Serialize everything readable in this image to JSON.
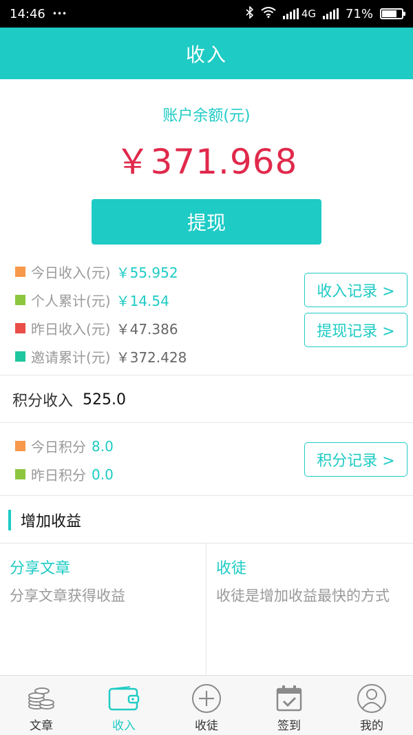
{
  "status_bar": {
    "time": "14:46",
    "dots": "•••",
    "network": "4G",
    "battery": "71%",
    "battery_level": 0.71
  },
  "header": {
    "title": "收入"
  },
  "balance": {
    "label": "账户余额(元)",
    "value": "￥371.968"
  },
  "withdraw_button": "提现",
  "stats": [
    {
      "label": "今日收入(元)",
      "value": "￥55.952",
      "color": "#f7984a",
      "tone": "teal"
    },
    {
      "label": "个人累计(元)",
      "value": "￥14.54",
      "color": "#8cc63f",
      "tone": "teal"
    },
    {
      "label": "昨日收入(元)",
      "value": "￥47.386",
      "color": "#e94e48",
      "tone": "gray"
    },
    {
      "label": "邀请累计(元)",
      "value": "￥372.428",
      "color": "#1fc7a0",
      "tone": "gray"
    }
  ],
  "buttons": {
    "income_record": "收入记录 >",
    "withdraw_record": "提现记录 >",
    "points_record": "积分记录 >"
  },
  "points": {
    "label": "积分收入",
    "value": "525.0"
  },
  "points_stats": [
    {
      "label": "今日积分",
      "value": "8.0",
      "color": "#f7984a"
    },
    {
      "label": "昨日积分",
      "value": "0.0",
      "color": "#8cc63f"
    }
  ],
  "section": {
    "title": "增加收益"
  },
  "cards": [
    {
      "title": "分享文章",
      "desc": "分享文章获得收益"
    },
    {
      "title": "收徒",
      "desc": "收徒是增加收益最快的方式"
    }
  ],
  "nav": [
    {
      "label": "文章",
      "icon": "coins-icon"
    },
    {
      "label": "收入",
      "icon": "wallet-icon",
      "active": true
    },
    {
      "label": "收徒",
      "icon": "plus-circle-icon"
    },
    {
      "label": "签到",
      "icon": "calendar-check-icon"
    },
    {
      "label": "我的",
      "icon": "user-circle-icon"
    }
  ],
  "colors": {
    "accent": "#1ecbc5",
    "balance": "#e0294b"
  }
}
